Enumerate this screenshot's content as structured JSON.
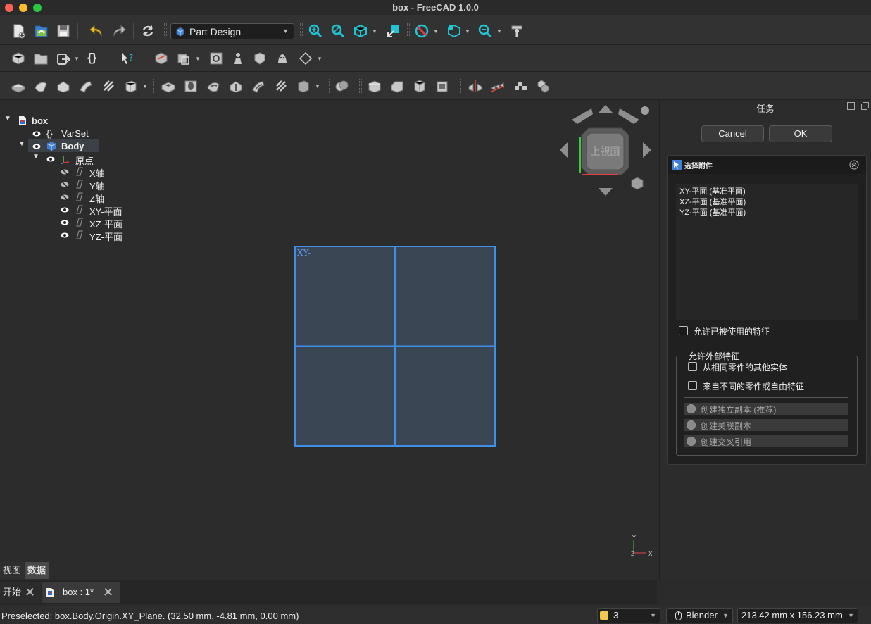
{
  "window": {
    "title": "box - FreeCAD 1.0.0"
  },
  "toolbar": {
    "workbench": "Part Design"
  },
  "tree": {
    "items": [
      {
        "label": "box"
      },
      {
        "label": "VarSet"
      },
      {
        "label": "Body"
      },
      {
        "label": "原点"
      },
      {
        "label": "X轴"
      },
      {
        "label": "Y轴"
      },
      {
        "label": "Z轴"
      },
      {
        "label": "XY-平面"
      },
      {
        "label": "XZ-平面"
      },
      {
        "label": "YZ-平面"
      }
    ]
  },
  "viewport": {
    "plane_label": "XY-",
    "navcube_face": "上視圖",
    "axis_labels": {
      "y": "Y",
      "z": "Z",
      "x": "X"
    }
  },
  "task": {
    "title": "任务",
    "cancel": "Cancel",
    "ok": "OK",
    "panel_title": "选择附件",
    "list_items": [
      "XY-平面 (基准平面)",
      "XZ-平面 (基准平面)",
      "YZ-平面 (基准平面)"
    ],
    "allow_used": "允许已被使用的特征",
    "external_group": "允许外部特征",
    "from_same_part": "从相同零件的其他实体",
    "from_other_part": "来自不同的零件或自由特征",
    "radios": [
      "创建独立副本 (推荐)",
      "创建关联副本",
      "创建交叉引用"
    ]
  },
  "bottom_tabs": {
    "view": "视图",
    "data": "数据"
  },
  "doc_tabs": {
    "start": "开始",
    "doc": "box : 1*"
  },
  "status": {
    "text": "Preselected: box.Body.Origin.XY_Plane. (32.50 mm, -4.81 mm, 0.00 mm)",
    "notifications": "3",
    "nav_style": "Blender",
    "dimensions": "213.42 mm x 156.23 mm"
  },
  "colors": {
    "selection": "#3f8fe8",
    "plane_fill": "#3b4654",
    "navcube_face": "#7a7a7a"
  }
}
